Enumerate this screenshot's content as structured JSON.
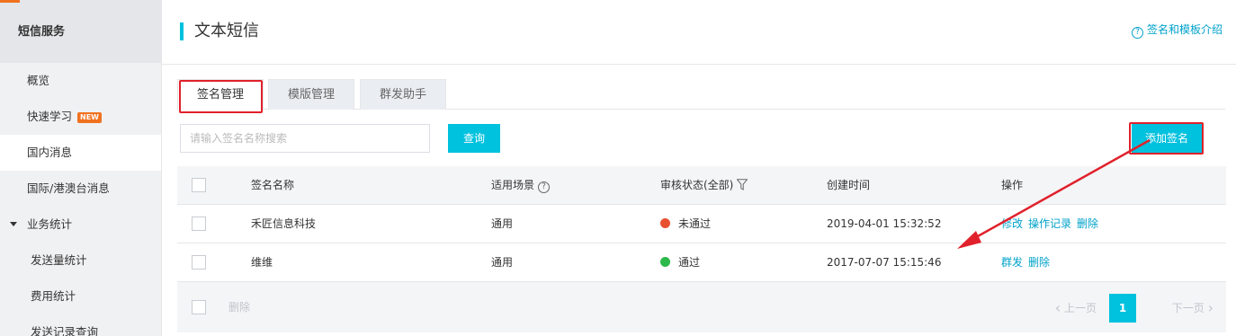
{
  "sidebar": {
    "section_title": "短信服务",
    "items": [
      {
        "label": "概览"
      },
      {
        "label": "快速学习",
        "badge": "NEW"
      },
      {
        "label": "国内消息"
      },
      {
        "label": "国际/港澳台消息"
      },
      {
        "label": "业务统计"
      },
      {
        "label": "发送量统计"
      },
      {
        "label": "费用统计"
      },
      {
        "label": "发送记录查询"
      }
    ],
    "active_item": "国内消息"
  },
  "header": {
    "title": "文本短信",
    "help_icon": "?",
    "help_link": "签名和模板介绍"
  },
  "tabs": [
    {
      "label": "签名管理",
      "active": true
    },
    {
      "label": "模版管理",
      "active": false
    },
    {
      "label": "群发助手",
      "active": false
    }
  ],
  "toolbar": {
    "search_placeholder": "请输入签名名称搜索",
    "query_label": "查询",
    "add_label": "添加签名"
  },
  "table": {
    "columns": {
      "name": "签名名称",
      "scene": "适用场景",
      "status": "审核状态(全部)",
      "created": "创建时间",
      "ops": "操作"
    },
    "rows": [
      {
        "name": "禾匠信息科技",
        "scene": "通用",
        "status": "未通过",
        "status_color": "#e8512f",
        "created": "2019-04-01 15:32:52",
        "ops": [
          "修改",
          "操作记录",
          "删除"
        ]
      },
      {
        "name": "维维",
        "scene": "通用",
        "status": "通过",
        "status_color": "#2eb84b",
        "created": "2017-07-07 15:15:46",
        "ops": [
          "群发",
          "删除"
        ]
      }
    ],
    "footer": {
      "delete_label": "删除",
      "prev_label": "上一页",
      "current_page": "1",
      "next_label": "下一页"
    }
  },
  "colors": {
    "accent": "#00c1de",
    "link": "#00a2ca",
    "annotation_red": "#e0212b"
  }
}
